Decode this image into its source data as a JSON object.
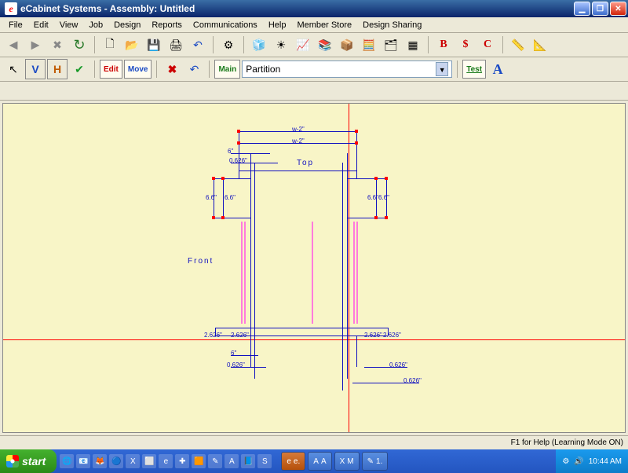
{
  "title": "eCabinet Systems - Assembly: Untitled",
  "app_icon_letter": "e",
  "menu": [
    "File",
    "Edit",
    "View",
    "Job",
    "Design",
    "Reports",
    "Communications",
    "Help",
    "Member Store",
    "Design Sharing"
  ],
  "toolbar1": {
    "back": "◄",
    "fwd": "►",
    "stop": "✖",
    "reload": "↻",
    "new": "🗋",
    "open": "📂",
    "save": "💾",
    "print": "🖨",
    "undo": "↶",
    "settings": "⚙"
  },
  "toolbar1_icons": [
    "🧊",
    "☀",
    "📈",
    "📚",
    "📦",
    "🧮",
    "🗂",
    "▦",
    "B",
    "$",
    "C",
    "📏",
    "📐"
  ],
  "toolbar2": {
    "select": "↖",
    "v_tool": "V",
    "h_tool": "H",
    "check": "✔",
    "edit_btn": "Edit",
    "move_btn": "Move",
    "del": "✖",
    "undo2": "↶",
    "main_btn": "Main",
    "combo_value": "Partition",
    "test_btn": "Test",
    "text_tool": "A"
  },
  "canvas": {
    "labels": {
      "front": "Front",
      "top": "Top"
    },
    "dims": {
      "w2_top": "w-2\"",
      "w2_mid": "w-2\"",
      "six": "6\"",
      "p0626": "0.626\"",
      "h6_l": "6.6\"",
      "h6_l2": "6.6\"",
      "h6_r": "6.6\"",
      "h6_r2": "6.6\"",
      "b2626_l": "2.626\"",
      "b2626_l2": "2.626\"",
      "b2626_r": "2.626\"",
      "b2626_r2": "2.626\"",
      "bot_6": "6\"",
      "bot_0626a": "0.626\"",
      "bot_0626b": "0.626\"",
      "bot_0626c": "0.626\""
    }
  },
  "status": "F1 for Help (Learning Mode ON)",
  "taskbar": {
    "start": "start",
    "quick": [
      "🌐",
      "📧",
      "🦊",
      "🔵",
      "X",
      "⬜",
      "e",
      "✚",
      "🟧",
      "✎",
      "A",
      "📘",
      "S"
    ],
    "tasks": [
      {
        "icon": "e",
        "label": "e."
      },
      {
        "icon": "A",
        "label": "A"
      },
      {
        "icon": "X",
        "label": "M"
      },
      {
        "icon": "✎",
        "label": "1."
      }
    ],
    "clock": "10:44 AM"
  }
}
